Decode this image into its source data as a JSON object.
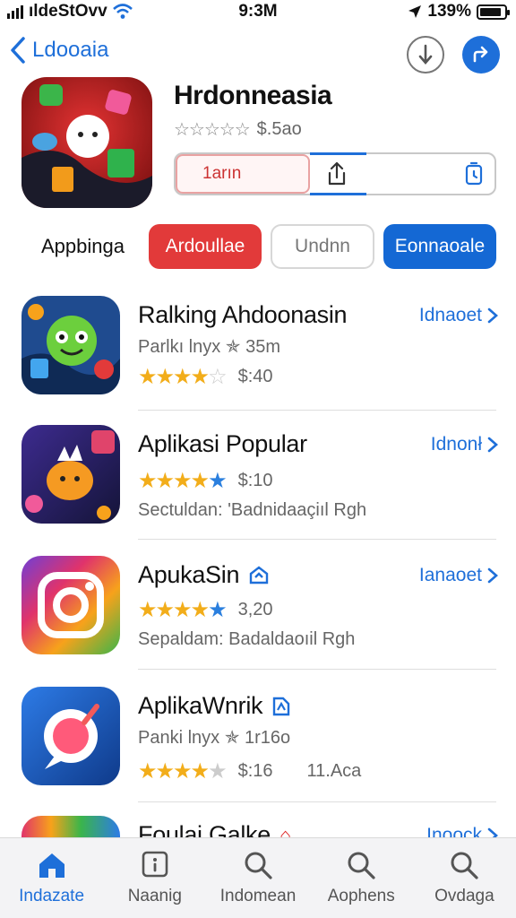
{
  "status_bar": {
    "carrier": "ıldeStOvv",
    "time": "9:3M",
    "battery": "139%",
    "battery_level": 0.9
  },
  "nav": {
    "back_label": "Ldooaia"
  },
  "hero": {
    "title": "Hrdonneasia",
    "stars": "☆☆☆☆☆",
    "price": "$.5ao",
    "bar_label": "1arın",
    "progress": 0.3
  },
  "filters": {
    "label": "Appbinga",
    "chips": [
      "Ardoullae",
      "Undnn",
      "Eonnaoale"
    ]
  },
  "apps": [
    {
      "name": "Ralking Ahdoonasin",
      "action": "Idnaoet",
      "line1": "Parlkı lnyx ✯ 35m",
      "rating": "$:40",
      "stars_full": "★★★★",
      "stars_rest": "☆"
    },
    {
      "name": "Aplikasi Popular",
      "action": "Idnonł",
      "rating": "$:10",
      "stars_full": "★★★★",
      "stars_rest": "★",
      "line2": "Sectuldan: 'Badnidaaçiıl Rgh"
    },
    {
      "name": "ApukaSin",
      "action": "Ianaoet",
      "rating": "3,20",
      "stars_full": "★★★★",
      "stars_rest": "★",
      "line2": "Sepaldam: Badaldaoıil Rgh"
    },
    {
      "name": "AplikaWnrik",
      "line1": "Panki lnyx ✯ 1r16o",
      "rating": "$:16",
      "stars_full": "★★★★",
      "stars_rest": "★",
      "extra": "11.Aca"
    },
    {
      "name": "Foulai Galke",
      "action": "Inoock"
    }
  ],
  "tabs": [
    "Indazate",
    "Naanig",
    "Indomean",
    "Aophens",
    "Ovdaga"
  ],
  "colors": {
    "accent": "#1e6fd9",
    "chip_red": "#e23a3a",
    "chip_blue": "#1468d4",
    "star_gold": "#f2ad1a"
  }
}
